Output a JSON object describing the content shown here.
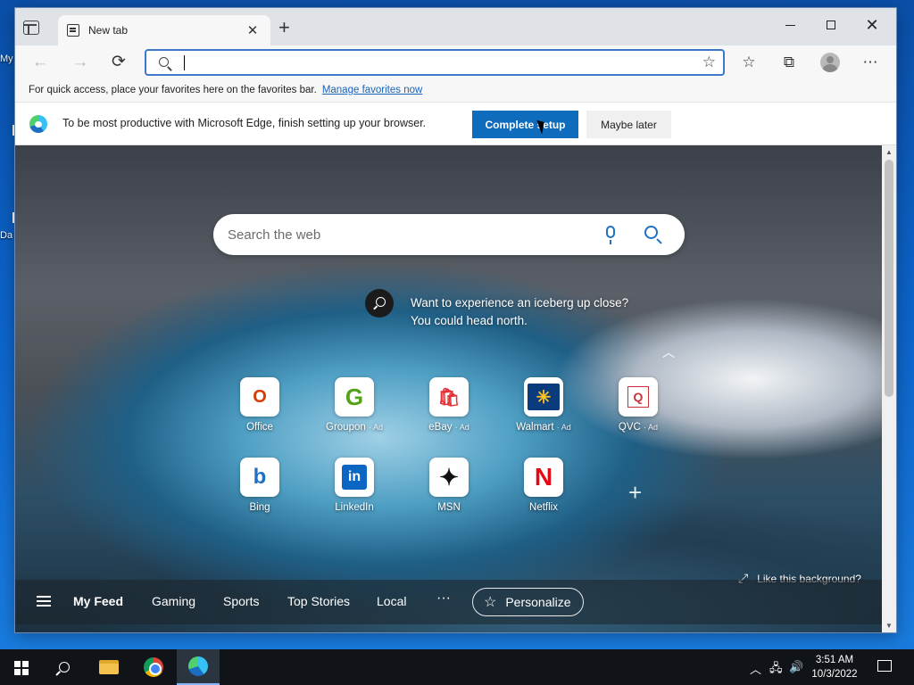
{
  "desktop": {
    "labels": [
      "My",
      "Da"
    ]
  },
  "tab": {
    "title": "New tab"
  },
  "address_bar": {
    "value": "",
    "placeholder": ""
  },
  "favorites_bar": {
    "text": "For quick access, place your favorites here on the favorites bar.",
    "link": "Manage favorites now"
  },
  "infobar": {
    "message": "To be most productive with Microsoft Edge, finish setting up your browser.",
    "primary": "Complete setup",
    "secondary": "Maybe later"
  },
  "ntp": {
    "search_placeholder": "Search the web",
    "promo_line1": "Want to experience an iceberg up close?",
    "promo_line2": "You could head north.",
    "like_background": "Like this background?",
    "tiles": [
      {
        "label": "Office",
        "ad": "",
        "glyph": "O",
        "color": "#d83b01"
      },
      {
        "label": "Groupon",
        "ad": "· Ad",
        "glyph": "G",
        "color": "#53a318"
      },
      {
        "label": "eBay",
        "ad": "· Ad",
        "glyph": "🛍",
        "color": "#e53238"
      },
      {
        "label": "Walmart",
        "ad": "· Ad",
        "glyph": "✳",
        "color": "#ffc220"
      },
      {
        "label": "QVC",
        "ad": "· Ad",
        "glyph": "Q",
        "color": "#c8333a"
      },
      {
        "label": "Bing",
        "ad": "",
        "glyph": "b",
        "color": "#1f6fc4"
      },
      {
        "label": "LinkedIn",
        "ad": "",
        "glyph": "in",
        "color": "#0a66c2"
      },
      {
        "label": "MSN",
        "ad": "",
        "glyph": "✦",
        "color": "#111111"
      },
      {
        "label": "Netflix",
        "ad": "",
        "glyph": "N",
        "color": "#e50914"
      }
    ]
  },
  "feed": {
    "items": [
      "My Feed",
      "Gaming",
      "Sports",
      "Top Stories",
      "Local"
    ],
    "more": "···",
    "personalize": "Personalize"
  },
  "taskbar": {
    "time": "3:51 AM",
    "date": "10/3/2022"
  },
  "icons": {
    "back": "←",
    "forward": "→",
    "refresh": "⟳",
    "favorites": "☆",
    "collections": "⧉",
    "more": "⋯",
    "add_fav": "☆",
    "close": "✕",
    "new_tab": "+",
    "collapse": "︿",
    "expand": "⤢",
    "star": "☆",
    "add_tile": "+",
    "tray_up": "︿",
    "network": "🖧",
    "volume": "🔊"
  },
  "colors": {
    "accent": "#0f6cbd",
    "address_border": "#3c79c9"
  }
}
